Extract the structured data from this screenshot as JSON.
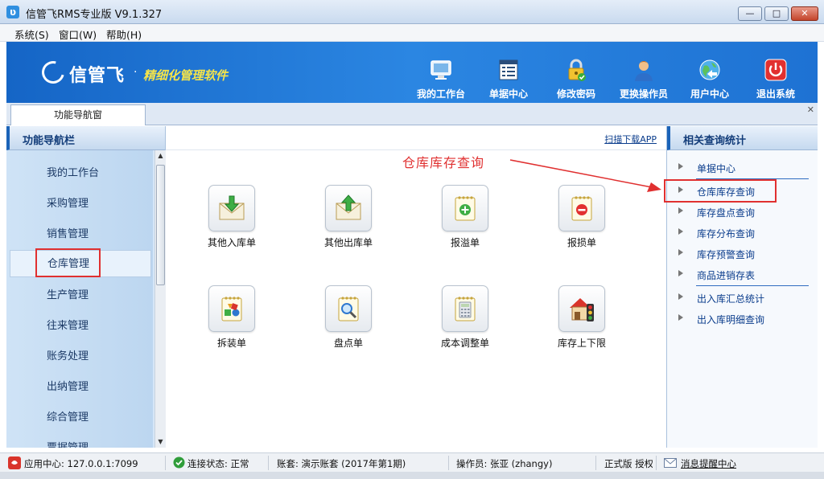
{
  "window": {
    "title": "信管飞RMS专业版 V9.1.327",
    "app_icon": "app-logo-icon",
    "controls": {
      "minimize": "—",
      "maximize": "□",
      "close": "✕"
    }
  },
  "menu": [
    "系统(S)",
    "窗口(W)",
    "帮助(H)"
  ],
  "banner": {
    "brand": "信管飞",
    "dot": "·",
    "slogan": "精细化管理软件",
    "toolbar": [
      {
        "label": "我的工作台",
        "icon": "monitor-icon"
      },
      {
        "label": "单据中心",
        "icon": "document-list-icon"
      },
      {
        "label": "修改密码",
        "icon": "lock-icon"
      },
      {
        "label": "更换操作员",
        "icon": "user-icon"
      },
      {
        "label": "用户中心",
        "icon": "globe-icon"
      },
      {
        "label": "退出系统",
        "icon": "power-icon"
      }
    ]
  },
  "tabs": [
    {
      "label": "功能导航窗"
    }
  ],
  "tab_close": "✕",
  "left_panel": {
    "title": "功能导航栏",
    "items": [
      "我的工作台",
      "采购管理",
      "销售管理",
      "仓库管理",
      "生产管理",
      "往来管理",
      "账务处理",
      "出纳管理",
      "综合管理",
      "票据管理"
    ],
    "selected": "仓库管理"
  },
  "content": {
    "scan_link": "扫描下载APP",
    "annotation": "仓库库存查询",
    "tiles": [
      {
        "label": "其他入库单",
        "icon": "inbound-envelope-icon"
      },
      {
        "label": "其他出库单",
        "icon": "outbound-envelope-icon"
      },
      {
        "label": "报溢单",
        "icon": "notepad-plus-icon"
      },
      {
        "label": "报损单",
        "icon": "notepad-stop-icon"
      },
      {
        "label": "拆装单",
        "icon": "shapes-notepad-icon"
      },
      {
        "label": "盘点单",
        "icon": "magnifier-notepad-icon"
      },
      {
        "label": "成本调整单",
        "icon": "calculator-notepad-icon"
      },
      {
        "label": "库存上下限",
        "icon": "house-traffic-light-icon"
      }
    ]
  },
  "right_panel": {
    "title": "相关查询统计",
    "items": [
      "单据中心",
      "仓库库存查询",
      "库存盘点查询",
      "库存分布查询",
      "库存预警查询",
      "商品进销存表",
      "出入库汇总统计",
      "出入库明细查询"
    ],
    "highlighted": "仓库库存查询"
  },
  "status_bar": {
    "app_center": "应用中心: 127.0.0.1:7099",
    "connection": "连接状态: 正常",
    "account": "账套: 演示账套 (2017年第1期)",
    "operator": "操作员: 张亚 (zhangy)",
    "edition": "正式版 授权",
    "message_center": "消息提醒中心"
  },
  "colors": {
    "banner": "#1e72d3",
    "annotation_red": "#e03030",
    "link_blue": "#0a3c8c",
    "slogan_yellow": "#f5e44a"
  }
}
